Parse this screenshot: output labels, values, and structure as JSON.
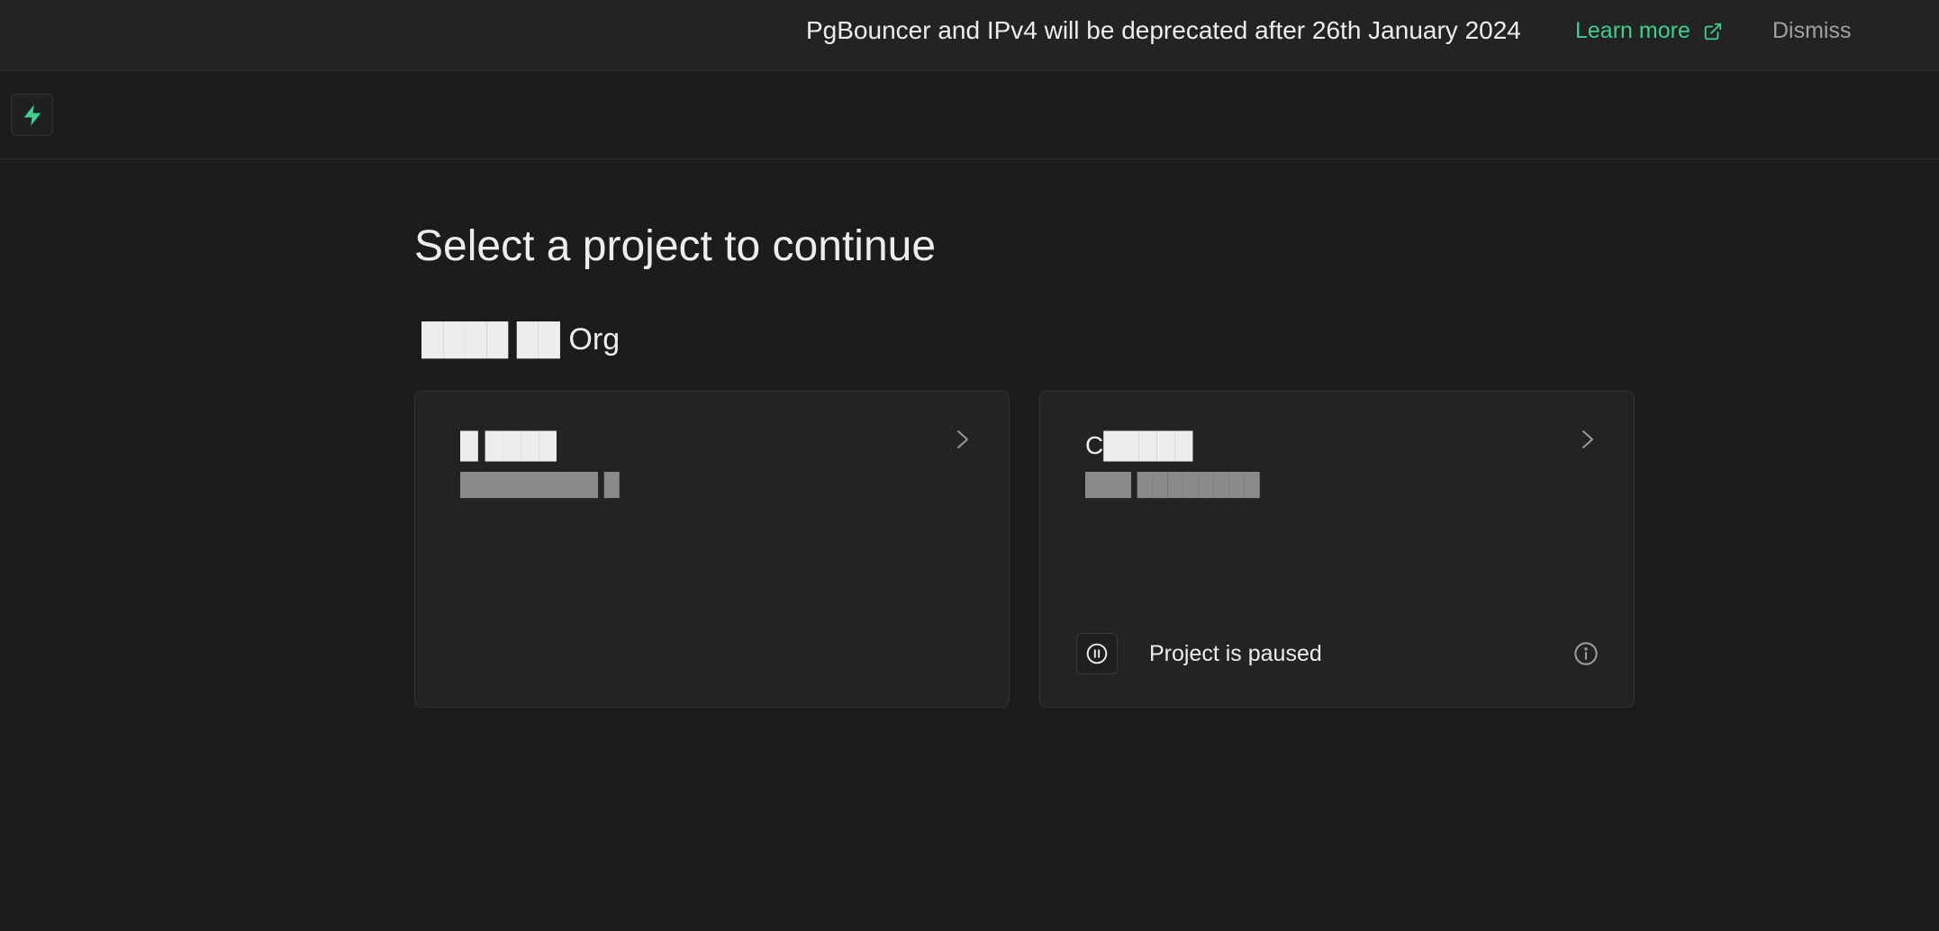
{
  "banner": {
    "message": "PgBouncer and IPv4 will be deprecated after 26th January 2024",
    "learn_more_label": "Learn more",
    "dismiss_label": "Dismiss"
  },
  "header": {
    "logo_icon": "supabase-logo-icon"
  },
  "main": {
    "title": "Select a project to continue",
    "organization": "████ ██ Org",
    "projects": [
      {
        "name": "█ ████",
        "subtitle": "█████████ █",
        "status": ""
      },
      {
        "name": "C█████",
        "subtitle": "███ ████████",
        "status": "Project is paused"
      }
    ]
  },
  "colors": {
    "background": "#1c1c1c",
    "banner_background": "#232323",
    "card_background": "#232323",
    "accent": "#3ecf8e",
    "text": "#ededed",
    "muted_text": "#a0a0a0"
  }
}
